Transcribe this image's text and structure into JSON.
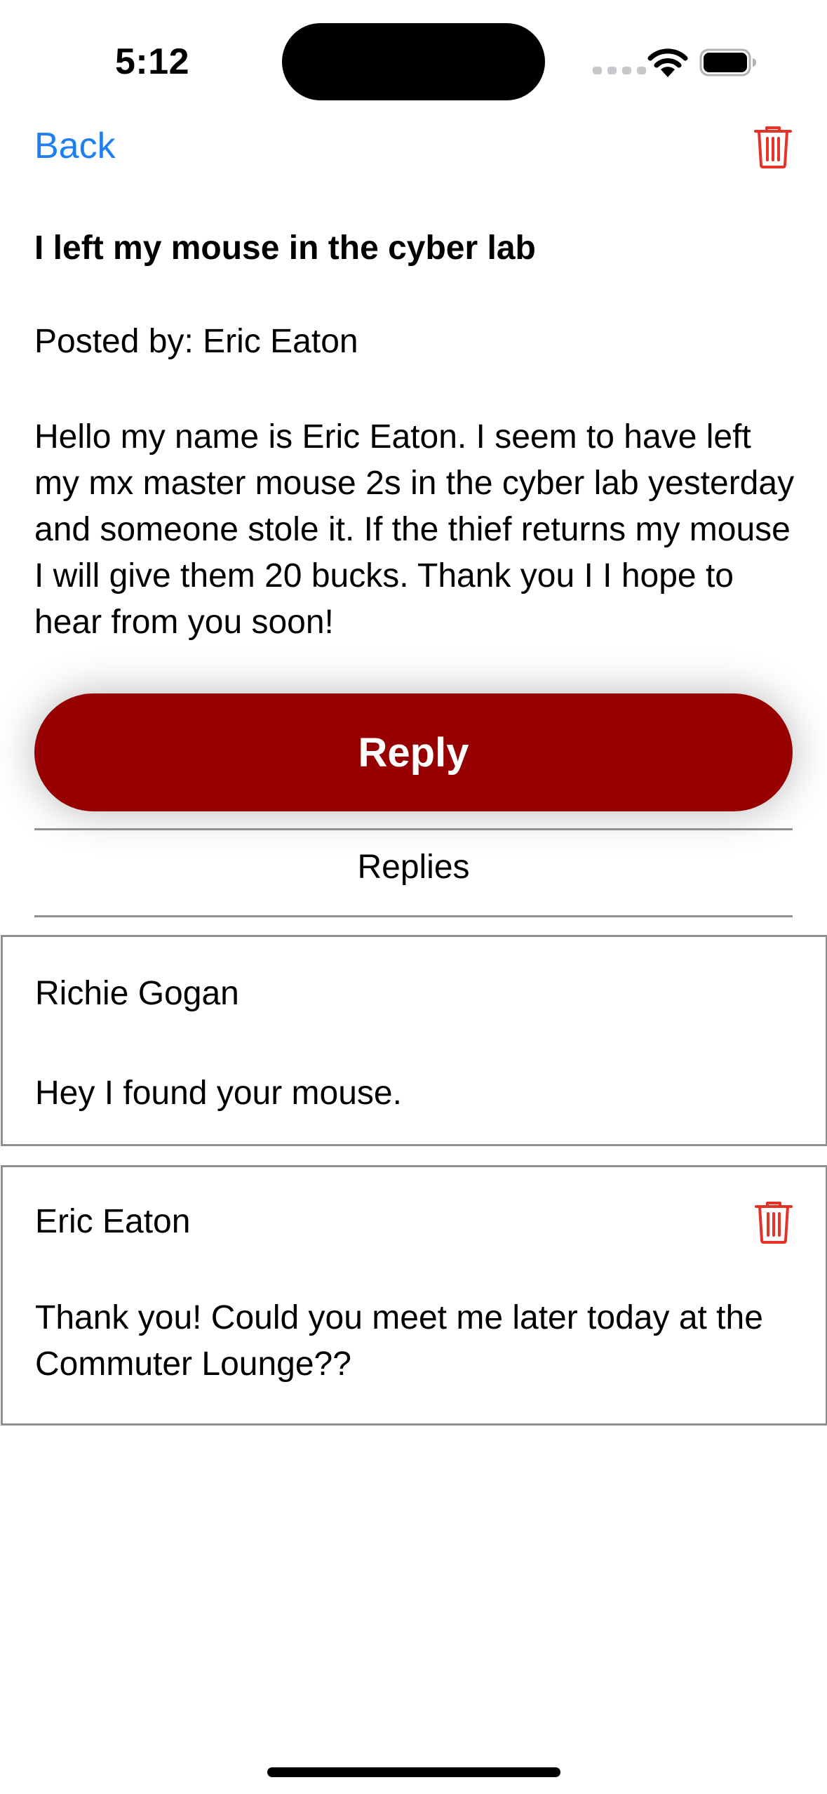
{
  "status_bar": {
    "time": "5:12"
  },
  "nav": {
    "back_label": "Back",
    "trash_icon": "trash-icon"
  },
  "post": {
    "title": "I left my mouse in the cyber lab",
    "posted_by": "Posted by: Eric Eaton",
    "body": "Hello my name is Eric Eaton. I seem to have left my mx master mouse 2s in the cyber lab yesterday and someone stole it. If the thief returns my mouse I will give them 20 bucks. Thank you I I hope to hear from you soon!"
  },
  "reply_button_label": "Reply",
  "replies_heading": "Replies",
  "replies": [
    {
      "author": "Richie Gogan",
      "body": "Hey I found your mouse."
    },
    {
      "author": "Eric Eaton",
      "body": "Thank you! Could you meet me later today at the Commuter Lounge??"
    }
  ],
  "colors": {
    "accent_link": "#1e7ff2",
    "reply_button": "#970000",
    "delete_icon": "#e5332a",
    "divider": "#8e8e93"
  }
}
